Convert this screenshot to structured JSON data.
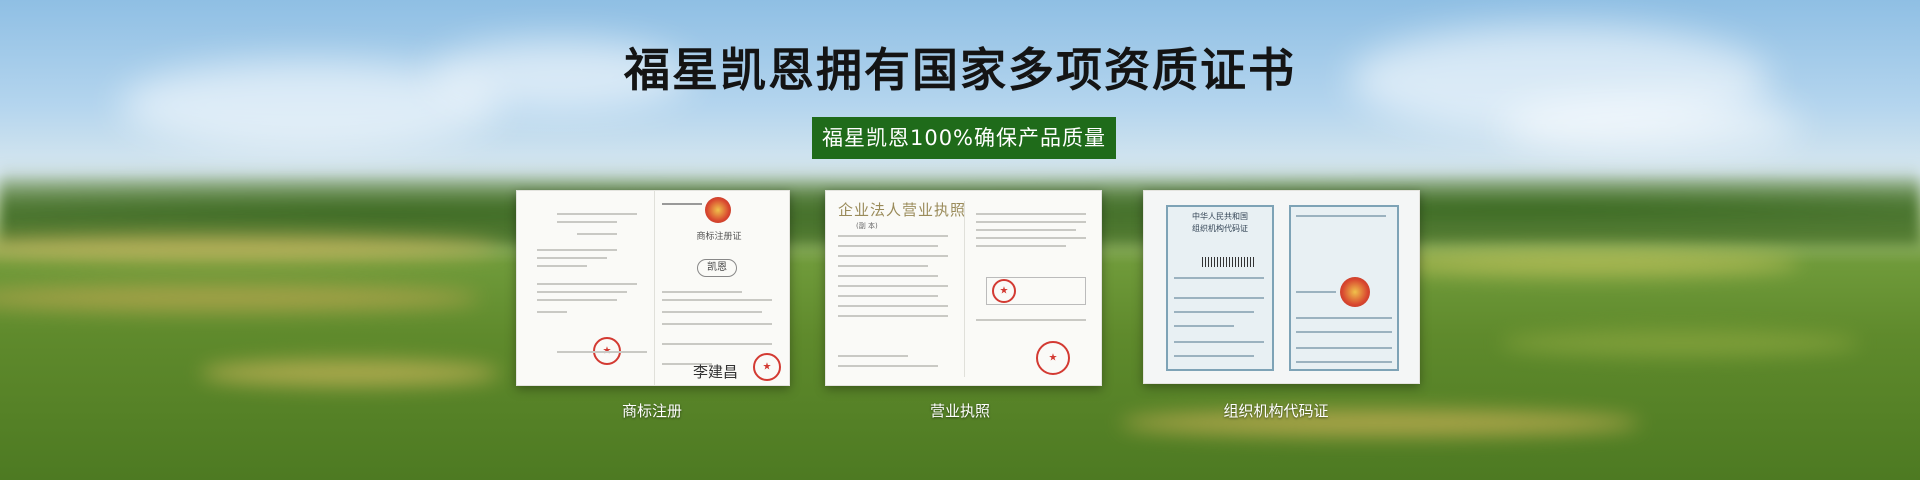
{
  "banner": {
    "title": "福星凯恩拥有国家多项资质证书",
    "subtitle": "福星凯恩100%确保产品质量",
    "subtitle_bg": "#1f6b1a"
  },
  "certificates": [
    {
      "caption": "商标注册",
      "doc_title": "商标注册证",
      "mark": "凯恩",
      "signature": "李建昌",
      "icon": "trademark-certificate-icon"
    },
    {
      "caption": "营业执照",
      "doc_title": "企业法人营业执照",
      "doc_subtitle": "(副 本)",
      "icon": "business-license-icon"
    },
    {
      "caption": "组织机构代码证",
      "doc_title_line1": "中华人民共和国",
      "doc_title_line2": "组织机构代码证",
      "icon": "organization-code-icon"
    }
  ]
}
